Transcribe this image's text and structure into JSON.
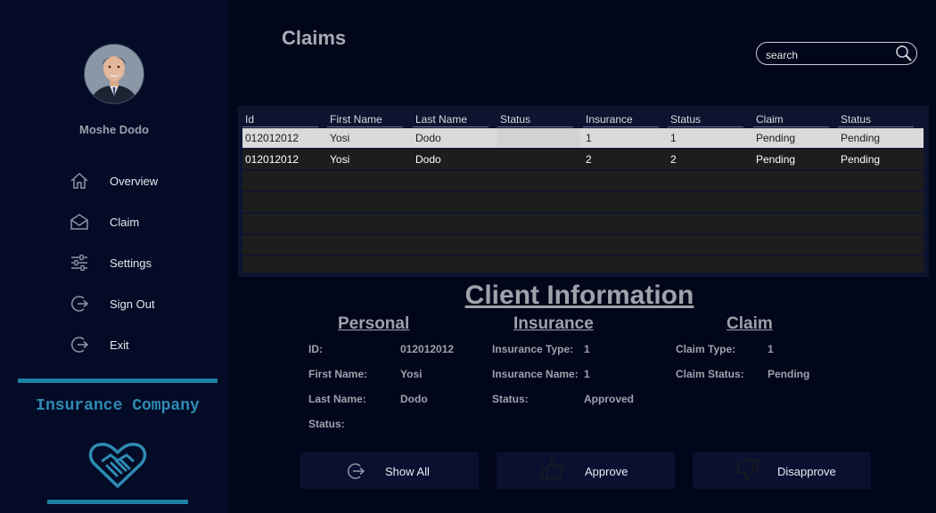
{
  "sidebar": {
    "user_name": "Moshe Dodo",
    "items": [
      {
        "label": "Overview",
        "icon": "home-icon"
      },
      {
        "label": "Claim",
        "icon": "envelope-icon"
      },
      {
        "label": "Settings",
        "icon": "sliders-icon"
      },
      {
        "label": "Sign Out",
        "icon": "sign-out-icon"
      },
      {
        "label": "Exit",
        "icon": "exit-icon"
      }
    ],
    "brand_name": "Insurance Company",
    "brand_icon": "heart-handshake-icon"
  },
  "header": {
    "title": "Claims",
    "search_placeholder": "search"
  },
  "table": {
    "columns": [
      "Id",
      "First Name",
      "Last Name",
      "Status",
      "Insurance",
      "Status",
      "Claim",
      "Status"
    ],
    "rows": [
      [
        "012012012",
        "Yosi",
        "Dodo",
        "",
        "1",
        "1",
        "Pending",
        "Pending"
      ],
      [
        "012012012",
        "Yosi",
        "Dodo",
        "",
        "2",
        "2",
        "Pending",
        "Pending"
      ]
    ]
  },
  "client_info": {
    "title": "Client Information",
    "personal": {
      "title": "Personal",
      "id_label": "ID:",
      "id_value": "012012012",
      "first_label": "First Name:",
      "first_value": "Yosi",
      "last_label": "Last Name:",
      "last_value": "Dodo",
      "status_label": "Status:",
      "status_value": ""
    },
    "insurance": {
      "title": "Insurance",
      "type_label": "Insurance Type:",
      "type_value": "1",
      "name_label": "Insurance Name:",
      "name_value": "1",
      "status_label": "Status:",
      "status_value": "Approved"
    },
    "claim": {
      "title": "Claim",
      "type_label": "Claim Type:",
      "type_value": "1",
      "status_label": "Claim Status:",
      "status_value": "Pending"
    }
  },
  "actions": {
    "show_all": "Show All",
    "approve": "Approve",
    "disapprove": "Disapprove"
  },
  "colors": {
    "background": "#02061a",
    "sidebar": "#040b26",
    "accent": "#1f7fa3",
    "selected_row": "#d9d9d9"
  }
}
